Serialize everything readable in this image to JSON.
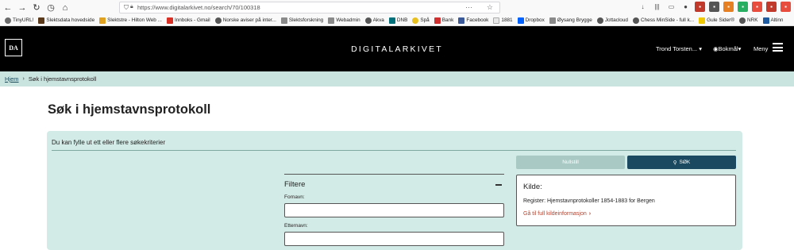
{
  "browser": {
    "url": "https://www.digitalarkivet.no/search/70/100318",
    "bookmarks": [
      {
        "label": "TinyURL!",
        "color": "#6a6a6a"
      },
      {
        "label": "Slektsdata hovedside",
        "color": "#5a3a1a"
      },
      {
        "label": "Slektstre - Hilton Web ...",
        "color": "#e0a020"
      },
      {
        "label": "Innboks - Gmail",
        "color": "#d93025"
      },
      {
        "label": "Norske aviser på inter...",
        "color": "#555555"
      },
      {
        "label": "Slektsforskning",
        "color": "#8a8a8a"
      },
      {
        "label": "Webadmin",
        "color": "#8a8a8a"
      },
      {
        "label": "Akva",
        "color": "#555555"
      },
      {
        "label": "DNB",
        "color": "#00707a"
      },
      {
        "label": "Spå",
        "color": "#e8c020"
      },
      {
        "label": "Bank",
        "color": "#d03030"
      },
      {
        "label": "Facebook",
        "color": "#3b5998"
      },
      {
        "label": "1881",
        "color": "#e8e8e8"
      },
      {
        "label": "Dropbox",
        "color": "#0061fe"
      },
      {
        "label": "Øysang Brygge",
        "color": "#8a8a8a"
      },
      {
        "label": "Jottacloud",
        "color": "#555555"
      },
      {
        "label": "Chess MinSide - full k...",
        "color": "#555555"
      },
      {
        "label": "Gule Sider®",
        "color": "#f0c800"
      },
      {
        "label": "NRK",
        "color": "#555555"
      },
      {
        "label": "Altinn",
        "color": "#1e5aa0"
      }
    ]
  },
  "header": {
    "logo": "DA",
    "title": "DIGITALARKIVET",
    "user": "Trond Torsten...",
    "language": "Bokmål",
    "menu": "Meny"
  },
  "breadcrumb": {
    "home": "Hjem",
    "current": "Søk i hjemstavnsprotokoll"
  },
  "page": {
    "title": "Søk i hjemstavnsprotokoll",
    "panel_heading": "Du kan fylle ut ett eller flere søkekriterier"
  },
  "filters": {
    "title": "Filtere",
    "first_name_label": "Fornavn:",
    "first_name_value": "",
    "last_name_label": "Etternavn:",
    "last_name_value": ""
  },
  "actions": {
    "reset": "Nullstill",
    "search": "SØK"
  },
  "source": {
    "title": "Kilde:",
    "register": "Register: Hjemstavnprotokoller 1854-1883 for Bergen",
    "link": "Gå til full kildeinformasjon"
  }
}
